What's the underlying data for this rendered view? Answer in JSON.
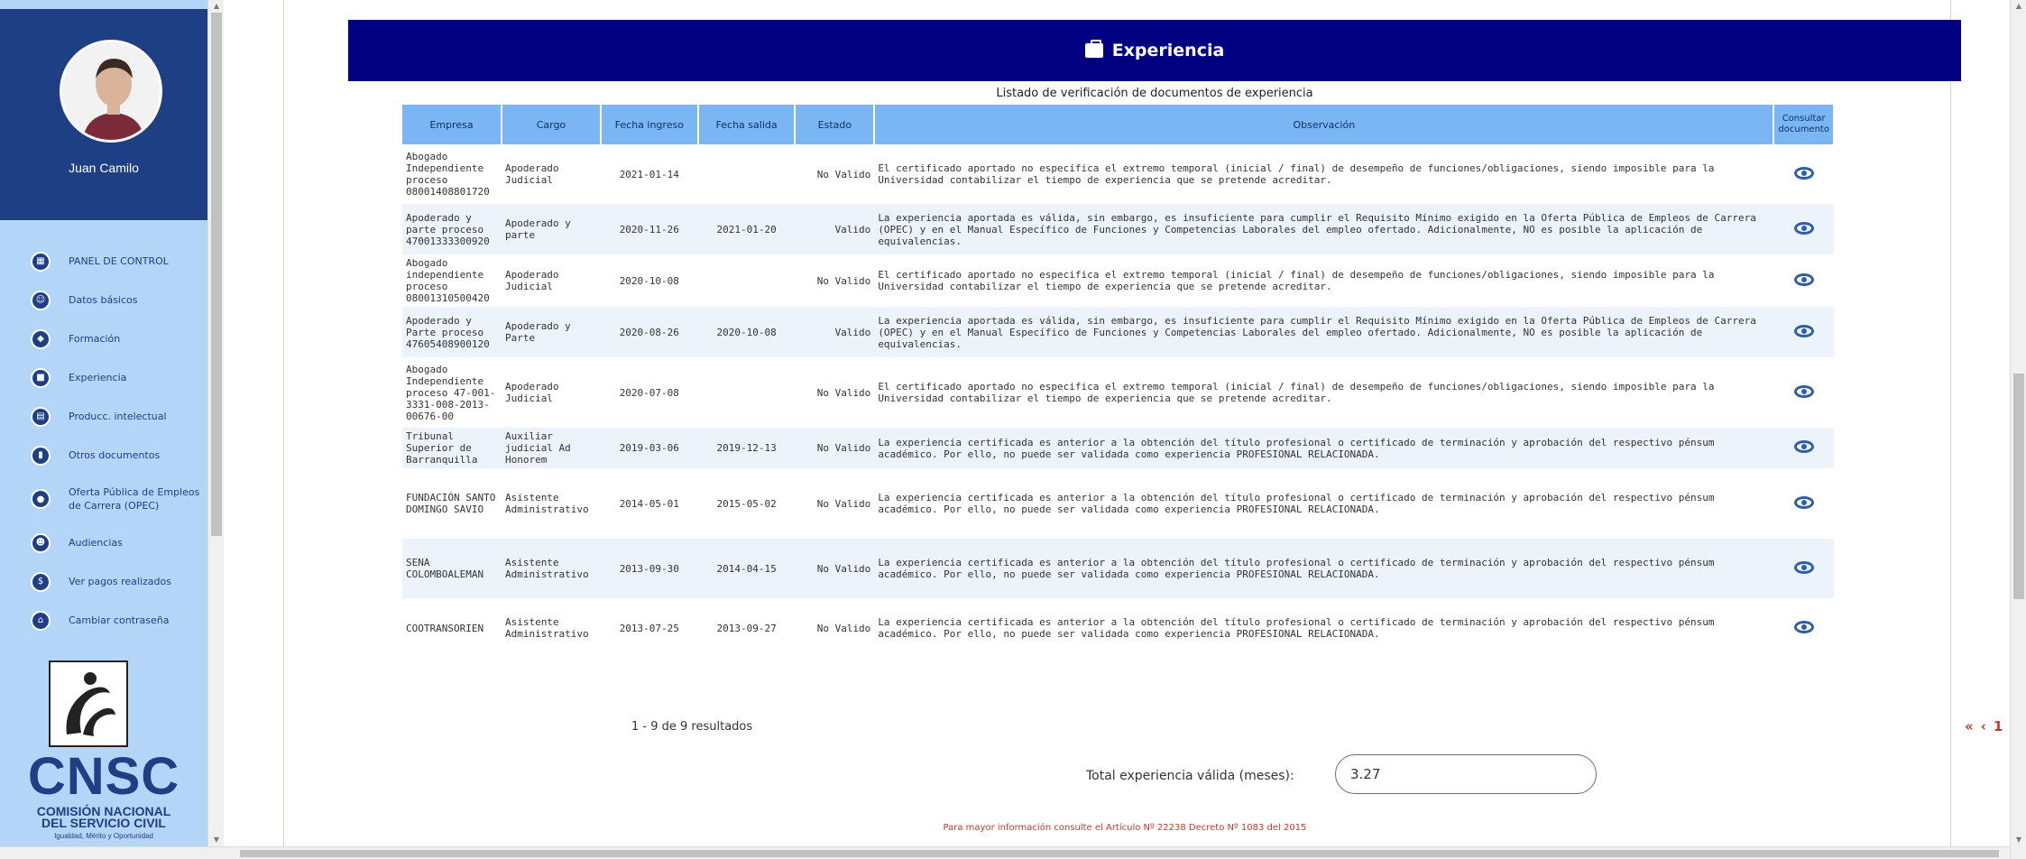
{
  "sidebar": {
    "username": "Juan Camilo",
    "menu": [
      {
        "label": "PANEL DE CONTROL",
        "icon": "dashboard-icon"
      },
      {
        "label": "Datos básicos",
        "icon": "people-icon"
      },
      {
        "label": "Formación",
        "icon": "graduation-icon"
      },
      {
        "label": "Experiencia",
        "icon": "briefcase-icon"
      },
      {
        "label": "Producc. intelectual",
        "icon": "book-icon"
      },
      {
        "label": "Otros documentos",
        "icon": "document-icon"
      },
      {
        "label": "Oferta Pública de Empleos de Carrera (OPEC)",
        "icon": "offer-icon"
      },
      {
        "label": "Audiencias",
        "icon": "audience-icon"
      },
      {
        "label": "Ver pagos realizados",
        "icon": "dollar-icon"
      },
      {
        "label": "Cambiar contraseña",
        "icon": "lock-icon"
      }
    ],
    "logo": {
      "name": "CNSC",
      "sub1": "COMISIÓN NACIONAL",
      "sub2": "DEL SERVICIO CIVIL",
      "tagline": "Igualdad, Mérito y Oportunidad"
    }
  },
  "main": {
    "section_title": "Experiencia",
    "table_caption": "Listado de verificación de documentos de experiencia",
    "columns": [
      "Empresa",
      "Cargo",
      "Fecha ingreso",
      "Fecha salida",
      "Estado",
      "Observación",
      "Consultar documento"
    ],
    "rows": [
      {
        "empresa": "Abogado Independiente proceso 08001408801720",
        "cargo": "Apoderado Judicial",
        "ingreso": "2021-01-14",
        "salida": "",
        "estado": "No Valido",
        "obs": "El certificado aportado no especifica el extremo temporal (inicial / final) de desempeño de funciones/obligaciones, siendo imposible para la Universidad contabilizar el tiempo de experiencia que se pretende acreditar."
      },
      {
        "empresa": "Apoderado y parte proceso 47001333300920",
        "cargo": "Apoderado y parte",
        "ingreso": "2020-11-26",
        "salida": "2021-01-20",
        "estado": "Valido",
        "obs": "La experiencia aportada es válida, sin embargo, es insuficiente para cumplir el Requisito Mínimo exigido en la Oferta Pública de Empleos de Carrera (OPEC) y en el Manual Específico de Funciones y Competencias Laborales del empleo ofertado. Adicionalmente, NO es posible la aplicación de equivalencias."
      },
      {
        "empresa": "Abogado independiente proceso 08001310500420",
        "cargo": "Apoderado Judicial",
        "ingreso": "2020-10-08",
        "salida": "",
        "estado": "No Valido",
        "obs": "El certificado aportado no especifica el extremo temporal (inicial / final) de desempeño de funciones/obligaciones, siendo imposible para la Universidad contabilizar el tiempo de experiencia que se pretende acreditar."
      },
      {
        "empresa": "Apoderado y Parte proceso 47605408900120",
        "cargo": "Apoderado y Parte",
        "ingreso": "2020-08-26",
        "salida": "2020-10-08",
        "estado": "Valido",
        "obs": "La experiencia aportada es válida, sin embargo, es insuficiente para cumplir el Requisito Mínimo exigido en la Oferta Pública de Empleos de Carrera (OPEC) y en el Manual Específico de Funciones y Competencias Laborales del empleo ofertado. Adicionalmente, NO es posible la aplicación de equivalencias."
      },
      {
        "empresa": "Abogado Independiente proceso 47-001-3331-008-2013-00676-00",
        "cargo": "Apoderado Judicial",
        "ingreso": "2020-07-08",
        "salida": "",
        "estado": "No Valido",
        "obs": "El certificado aportado no especifica el extremo temporal (inicial / final) de desempeño de funciones/obligaciones, siendo imposible para la Universidad contabilizar el tiempo de experiencia que se pretende acreditar."
      },
      {
        "empresa": "Tribunal Superior de Barranquilla",
        "cargo": "Auxiliar judicial Ad Honorem",
        "ingreso": "2019-03-06",
        "salida": "2019-12-13",
        "estado": "No Valido",
        "obs": "La experiencia certificada es anterior a la obtención del título profesional o certificado de terminación y aprobación del respectivo pénsum académico. Por ello, no puede ser validada como experiencia PROFESIONAL RELACIONADA."
      },
      {
        "empresa": "FUNDACIÓN SANTO DOMINGO SAVIO",
        "cargo": "Asistente Administrativo",
        "ingreso": "2014-05-01",
        "salida": "2015-05-02",
        "estado": "No Valido",
        "obs": "La experiencia certificada es anterior a la obtención del título profesional o certificado de terminación y aprobación del respectivo pénsum académico. Por ello, no puede ser validada como experiencia PROFESIONAL RELACIONADA."
      },
      {
        "empresa": "SENA COLOMBOALEMAN",
        "cargo": "Asistente Administrativo",
        "ingreso": "2013-09-30",
        "salida": "2014-04-15",
        "estado": "No Valido",
        "obs": "La experiencia certificada es anterior a la obtención del título profesional o certificado de terminación y aprobación del respectivo pénsum académico. Por ello, no puede ser validada como experiencia PROFESIONAL RELACIONADA."
      },
      {
        "empresa": "COOTRANSORIEN",
        "cargo": "Asistente Administrativo",
        "ingreso": "2013-07-25",
        "salida": "2013-09-27",
        "estado": "No Valido",
        "obs": "La experiencia certificada es anterior a la obtención del título profesional o certificado de terminación y aprobación del respectivo pénsum académico. Por ello, no puede ser validada como experiencia PROFESIONAL RELACIONADA."
      }
    ],
    "results_count": "1 - 9 de 9 resultados",
    "pager": {
      "first": "«",
      "prev": "‹",
      "page": "1",
      "next": "›",
      "last": "»"
    },
    "total_label": "Total experiencia válida (meses):",
    "total_value": "3.27",
    "footnote": "Para mayor información consulte el Artículo Nº 22238 Decreto Nº 1083 del 2015"
  },
  "colors": {
    "sidebar_bg": "#b3d5f8",
    "profile_bg": "#1e3f84",
    "header_band": "#000080",
    "table_header": "#7ab6f3",
    "accent_red": "#c0392b"
  }
}
